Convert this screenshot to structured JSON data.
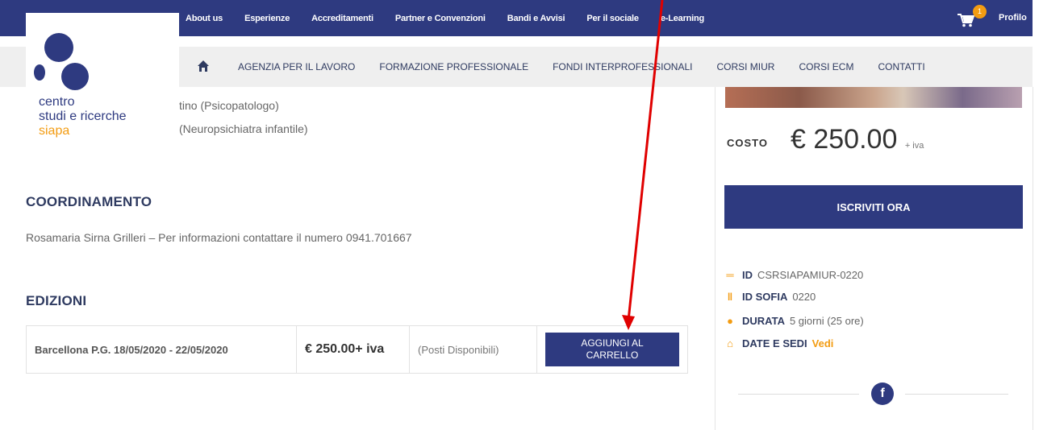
{
  "topnav": {
    "items": [
      "About us",
      "Esperienze",
      "Accreditamenti",
      "Partner e Convenzioni",
      "Bandi e Avvisi",
      "Per il sociale",
      "e-Learning"
    ],
    "cart_count": "1",
    "profile": "Profilo"
  },
  "subnav": {
    "items": [
      "AGENZIA PER IL LAVORO",
      "FORMAZIONE PROFESSIONALE",
      "FONDI INTERPROFESSIONALI",
      "CORSI MIUR",
      "CORSI ECM",
      "CONTATTI"
    ]
  },
  "logo": {
    "line1": "centro",
    "line2": "studi e ricerche",
    "line3": "siapa"
  },
  "content": {
    "teacher1": "tino (Psicopatologo)",
    "teacher2": "(Neuropsichiatra infantile)",
    "coord_title": "COORDINAMENTO",
    "coord_text": "Rosamaria Sirna Grilleri – Per informazioni contattare il numero 0941.701667",
    "editions_title": "EDIZIONI"
  },
  "edition": {
    "place": "Barcellona P.G. 18/05/2020 - 22/05/2020",
    "price": "€ 250.00+ iva",
    "availability": "(Posti Disponibili)",
    "button_line1": "AGGIUNGI AL",
    "button_line2": "CARRELLO"
  },
  "sidebar": {
    "cost_label": "COSTO",
    "cost_value": "€ 250.00",
    "cost_iva": "+ iva",
    "enroll": "ISCRIVITI ORA",
    "id_label": "ID",
    "id_value": "CSRSIAPAMIUR-0220",
    "sofia_label": "ID SOFIA",
    "sofia_value": "0220",
    "duration_label": "DURATA",
    "duration_value": "5 giorni (25 ore)",
    "dates_label": "DATE E SEDI",
    "dates_link": "Vedi",
    "facebook": "f"
  },
  "colors": {
    "brand_navy": "#2e3a80",
    "accent_orange": "#f39c12",
    "annotation_red": "#e00000"
  }
}
